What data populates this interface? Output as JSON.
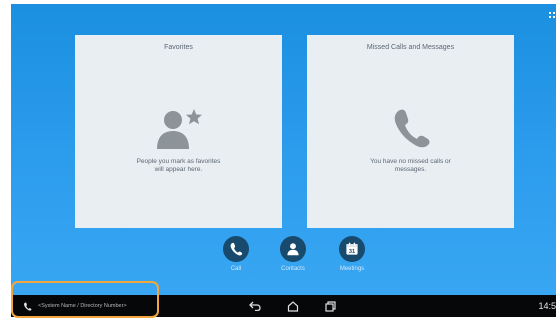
{
  "favorites": {
    "title": "Favorites",
    "message": "People you mark as favorites\nwill appear here.",
    "icon": "person-star-icon"
  },
  "missed": {
    "title": "Missed Calls and Messages",
    "message": "You have no missed calls or\nmessages.",
    "icon": "phone-icon"
  },
  "dock": {
    "call_label": "Call",
    "contacts_label": "Contacts",
    "meetings_label": "Meetings",
    "calendar_day": "31"
  },
  "navbar": {
    "system_name": "<System Name / Directory Number>",
    "clock": "14:5"
  },
  "colors": {
    "background": "#2b9bec",
    "card": "#e9eef3",
    "dock_button": "#174a6c",
    "navbar": "#050708",
    "highlight": "#f2a640"
  }
}
